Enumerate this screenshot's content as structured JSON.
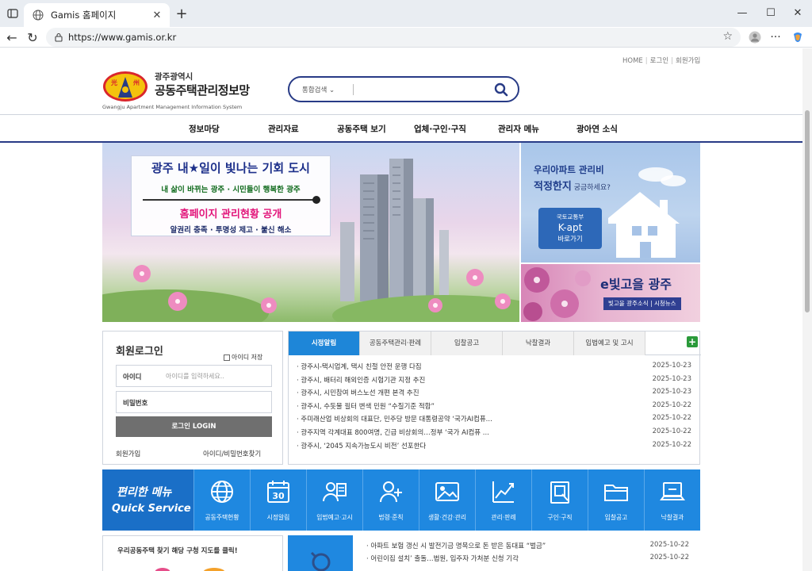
{
  "browser": {
    "tab_title": "Gamis 홈페이지",
    "url": "https://www.gamis.or.kr"
  },
  "util_links": [
    "HOME",
    "로그인",
    "회원가입"
  ],
  "logo": {
    "line1": "광주광역시",
    "line2": "공동주택관리정보망",
    "line3": "Gwangju Apartment Management Information System",
    "emblem_left": "光",
    "emblem_right": "州"
  },
  "search": {
    "scope": "통합검색",
    "placeholder": ""
  },
  "gnb": [
    "정보마당",
    "관리자료",
    "공동주택 보기",
    "업체·구인·구직",
    "관리자 메뉴",
    "광아연 소식"
  ],
  "hero": {
    "line1": "광주 내★일이 빛나는 기회 도시",
    "line2": "내 삶이 바뀌는 광주 · 시민들이 행복한 광주",
    "line3": "홈페이지 관리현황 공개",
    "line4": "알권리 충족 · 투명성 제고 · 불신 해소"
  },
  "side_banner_top": {
    "line1": "우리아파트 관리비",
    "line2_main": "적정한지",
    "line2_small": " 궁금하세요?",
    "kapt_line1": "국토교통부",
    "kapt_line2": "K-apt",
    "kapt_line3": "바로가기"
  },
  "side_banner_bottom": {
    "title": "e빛고을 광주",
    "sub": "빛고을 광주소식 | 시청뉴스"
  },
  "login": {
    "title": "회원로그인",
    "save_id": "아이디 저장",
    "id_label": "아이디",
    "id_placeholder": "아이디를 입력하세요..",
    "pw_label": "비밀번호",
    "button": "로그인 LOGIN",
    "signup": "회원가입",
    "find": "아이디/비밀번호찾기"
  },
  "news": {
    "tabs": [
      "시정알림",
      "공동주택관리·판례",
      "입찰공고",
      "낙찰결과",
      "입법예고 및 고시"
    ],
    "more": "+",
    "items": [
      {
        "title": "· 광주시-택시업계, 택시 친절 안전 운행 다짐",
        "date": "2025-10-23"
      },
      {
        "title": "· 광주시, 배터리 해외인증 시험기관 지정 추진",
        "date": "2025-10-23"
      },
      {
        "title": "· 광주시, 시민참여 버스노선 개편 본격 추진",
        "date": "2025-10-23"
      },
      {
        "title": "· 광주시, 수돗물 필터 변색 민원 “수질기준 적합”",
        "date": "2025-10-22"
      },
      {
        "title": "· 주미래산업 비상회의 대표단, 민주당 방문 대통령공약 ‘국가AI컴퓨...",
        "date": "2025-10-22"
      },
      {
        "title": "· 광주지역 각계대표 800여명, 긴급 비상회의…정부 ‘국가 AI컴퓨 ...",
        "date": "2025-10-22"
      },
      {
        "title": "· 광주시, ‘2045 지속가능도시 비전’ 선포한다",
        "date": "2025-10-22"
      }
    ]
  },
  "quick": {
    "title1": "편리한 메뉴",
    "title2": "Quick Service",
    "items": [
      {
        "label": "공동주택현황",
        "icon": "globe-icon"
      },
      {
        "label": "시정알림",
        "icon": "calendar-icon"
      },
      {
        "label": "입법예고·고시",
        "icon": "person-document-icon"
      },
      {
        "label": "법령·준칙",
        "icon": "person-add-icon"
      },
      {
        "label": "생활·건강·관리",
        "icon": "image-icon"
      },
      {
        "label": "관리·판례",
        "icon": "chart-icon"
      },
      {
        "label": "구인·구직",
        "icon": "clipboard-icon"
      },
      {
        "label": "입찰공고",
        "icon": "folder-icon"
      },
      {
        "label": "낙찰결과",
        "icon": "laptop-icon"
      }
    ],
    "calendar_day": "30"
  },
  "bottom": {
    "map_title": "우리공동주택 찾기 해당 구청 지도를 클릭!",
    "news2": [
      {
        "title": "· 아파트 보험 갱신 시 발전기금 명목으로 돈 받은 동대표 “벌금”",
        "date": "2025-10-22"
      },
      {
        "title": "· 어린이집 설치’ 출돌…법원, 입주자 가처분 신청 기각",
        "date": "2025-10-22"
      }
    ]
  },
  "colors": {
    "navy": "#283b86",
    "blue": "#1f88e0",
    "active_tab": "#1e86d8"
  }
}
